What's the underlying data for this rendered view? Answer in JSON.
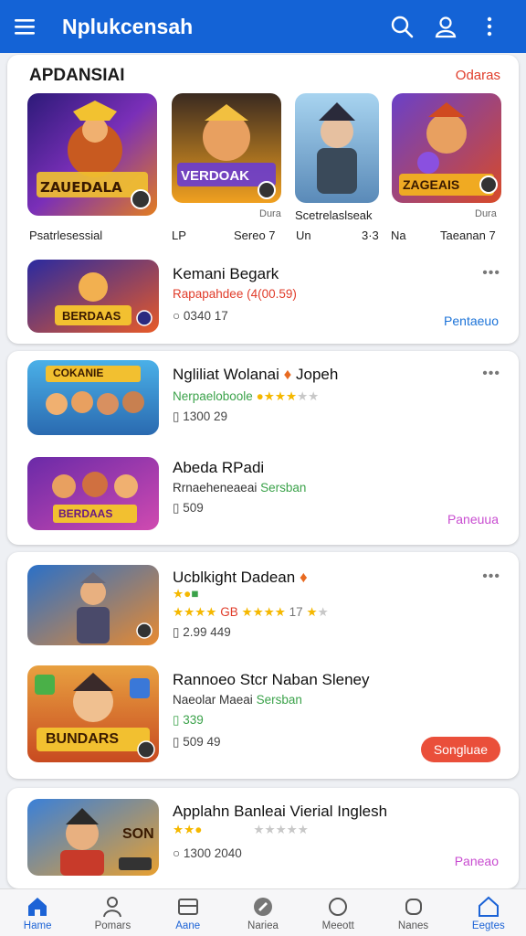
{
  "appbar": {
    "title": "Nplukcensah"
  },
  "featured": {
    "title": "APDANSIAI",
    "link": "Odaras",
    "thumbs": [
      {
        "banner": "ZAUEDALA",
        "caption": "Psatrlesessial"
      },
      {
        "banner": "VERDOAK",
        "caption": "Dura"
      },
      {
        "banner": "",
        "caption": "Scetrelaslseak"
      },
      {
        "banner": "ZAGEAIS",
        "caption": "Dura"
      }
    ],
    "meta": [
      "LP",
      "Sereo 7",
      "Un",
      "3·3",
      "Na",
      "Taeanan 7"
    ]
  },
  "items": [
    {
      "banner": "BERDAAS",
      "title": "Kemani Begark",
      "sub": "Rapapahdee (4(00.59)",
      "meta": "0340 17",
      "action": "Pentaeuo"
    },
    {
      "banner": "COKANIE",
      "title": "Ngliliat Wolanai",
      "title_suffix": "Jopeh",
      "sub": "Nerpaeloboole",
      "meta": "1300 29"
    },
    {
      "banner": "BERDAAS",
      "title": "Abeda RPadi",
      "sub": "Rrnaeheneaeai",
      "sub2": "Sersban",
      "meta": "509",
      "action": "Paneuua"
    },
    {
      "banner": "",
      "title": "Ucblkight Dadean",
      "sub": "GB",
      "sub_rating": "17",
      "meta": "2.99 449"
    },
    {
      "banner": "BUNDARS",
      "title": "Rannoeo Stcr Naban Sleney",
      "sub": "Naeolar Maeai",
      "sub2": "Sersban",
      "meta1": "339",
      "meta": "509 49",
      "action": "Songluae"
    },
    {
      "banner": "SON",
      "title": "Applahn Banleai Vierial Inglesh",
      "meta": "1300 2040",
      "action": "Paneao"
    }
  ],
  "nav": [
    {
      "label": "Hame",
      "icon": "home-icon"
    },
    {
      "label": "Pomars",
      "icon": "person-icon"
    },
    {
      "label": "Aane",
      "icon": "window-icon"
    },
    {
      "label": "Nariea",
      "icon": "chat-icon"
    },
    {
      "label": "Meeott",
      "icon": "circle-icon"
    },
    {
      "label": "Nanes",
      "icon": "ring-icon"
    },
    {
      "label": "Eegtes",
      "icon": "house-outline-icon"
    }
  ],
  "colors": {
    "appbar": "#1463d6",
    "accent_red": "#e03c2a",
    "accent_green": "#3ba24a",
    "accent_blue": "#1c73d8",
    "accent_pink": "#c84cd0"
  }
}
